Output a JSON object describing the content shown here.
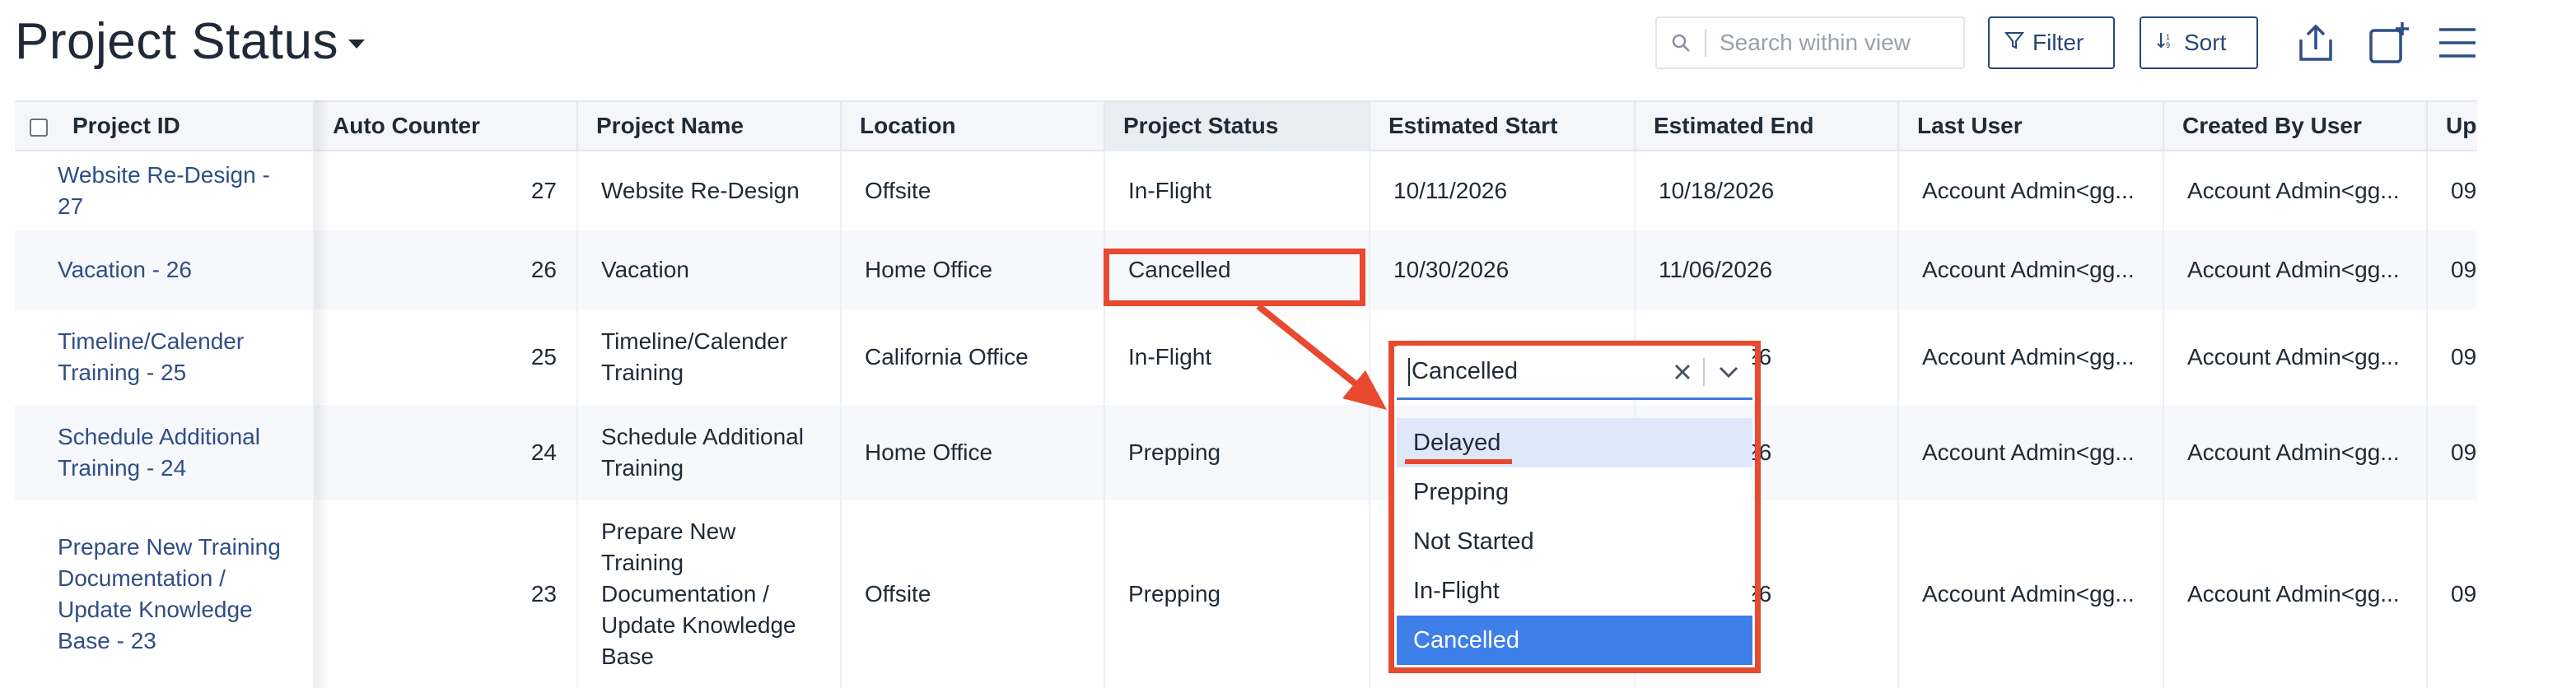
{
  "header": {
    "title": "Project Status",
    "search_placeholder": "Search within view",
    "filter_label": "Filter",
    "sort_label": "Sort"
  },
  "columns": [
    "Project ID",
    "Auto Counter",
    "Project Name",
    "Location",
    "Project Status",
    "Estimated Start",
    "Estimated End",
    "Last User",
    "Created By User",
    "Up"
  ],
  "rows": [
    {
      "id_l1": "Website Re-Design -",
      "id_l2": "27",
      "counter": "27",
      "name_l1": "Website Re-Design",
      "name_l2": "",
      "name_l3": "",
      "name_l4": "",
      "name_l5": "",
      "location": "Offsite",
      "status": "In-Flight",
      "start": "10/11/2026",
      "end": "10/18/2026",
      "last_user": "Account Admin<gg...",
      "created_by": "Account Admin<gg...",
      "up": "09"
    },
    {
      "id_l1": "Vacation  - 26",
      "id_l2": "",
      "counter": "26",
      "name_l1": "Vacation",
      "name_l2": "",
      "name_l3": "",
      "name_l4": "",
      "name_l5": "",
      "location": "Home Office",
      "status": "Cancelled",
      "start": "10/30/2026",
      "end": "11/06/2026",
      "last_user": "Account Admin<gg...",
      "created_by": "Account Admin<gg...",
      "up": "09"
    },
    {
      "id_l1": "Timeline/Calender",
      "id_l2": "Training - 25",
      "counter": "25",
      "name_l1": "Timeline/Calender",
      "name_l2": "Training",
      "name_l3": "",
      "name_l4": "",
      "name_l5": "",
      "location": "California Office",
      "status": "In-Flight",
      "start": "",
      "end": "26",
      "last_user": "Account Admin<gg...",
      "created_by": "Account Admin<gg...",
      "up": "09"
    },
    {
      "id_l1": "Schedule Additional",
      "id_l2": "Training - 24",
      "counter": "24",
      "name_l1": "Schedule Additional",
      "name_l2": "Training",
      "name_l3": "",
      "name_l4": "",
      "name_l5": "",
      "location": "Home Office",
      "status": "Prepping",
      "start": "",
      "end": "26",
      "last_user": "Account Admin<gg...",
      "created_by": "Account Admin<gg...",
      "up": "09"
    },
    {
      "id_l1": "Prepare New Training",
      "id_l2": "Documentation /",
      "id_l3": "Update Knowledge",
      "id_l4": "Base - 23",
      "counter": "23",
      "name_l1": "Prepare New",
      "name_l2": "Training",
      "name_l3": "Documentation /",
      "name_l4": "Update Knowledge",
      "name_l5": "Base",
      "location": "Offsite",
      "status": "Prepping",
      "start": "",
      "end": "26",
      "last_user": "Account Admin<gg...",
      "created_by": "Account Admin<gg...",
      "up": "09"
    }
  ],
  "dropdown": {
    "value": "Cancelled",
    "options": [
      "Delayed",
      "Prepping",
      "Not Started",
      "In-Flight",
      "Cancelled"
    ]
  },
  "colors": {
    "annotation": "#e8492f",
    "selected_option": "#3f7fea",
    "link": "#2f4e86",
    "button_border": "#27467a"
  }
}
